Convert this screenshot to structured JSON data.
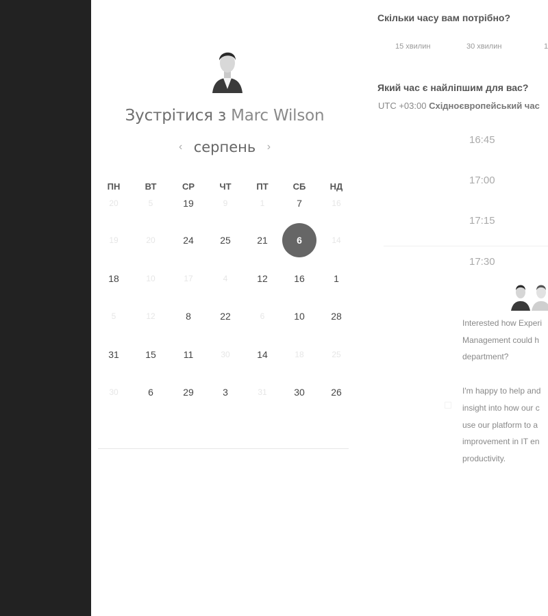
{
  "host": {
    "title_prefix": "Зустрітися з",
    "name": "Marc Wilson"
  },
  "calendar": {
    "month": "серпень",
    "prev_icon": "chevron-left-icon",
    "next_icon": "chevron-right-icon",
    "weekdays": [
      "ПН",
      "ВТ",
      "СР",
      "ЧТ",
      "ПТ",
      "СБ",
      "НД"
    ],
    "weeks": [
      [
        {
          "d": "20",
          "on": false
        },
        {
          "d": "5",
          "on": false
        },
        {
          "d": "19",
          "on": true
        },
        {
          "d": "9",
          "on": false
        },
        {
          "d": "1",
          "on": false
        },
        {
          "d": "7",
          "on": true
        },
        {
          "d": "16",
          "on": false
        }
      ],
      [
        {
          "d": "19",
          "on": false
        },
        {
          "d": "20",
          "on": false
        },
        {
          "d": "24",
          "on": true
        },
        {
          "d": "25",
          "on": true
        },
        {
          "d": "21",
          "on": true
        },
        {
          "d": "6",
          "on": true,
          "selected": true
        },
        {
          "d": "14",
          "on": false
        }
      ],
      [
        {
          "d": "18",
          "on": true
        },
        {
          "d": "10",
          "on": false
        },
        {
          "d": "17",
          "on": false
        },
        {
          "d": "4",
          "on": false
        },
        {
          "d": "12",
          "on": true
        },
        {
          "d": "16",
          "on": true
        },
        {
          "d": "1",
          "on": true
        }
      ],
      [
        {
          "d": "5",
          "on": false
        },
        {
          "d": "12",
          "on": false
        },
        {
          "d": "8",
          "on": true
        },
        {
          "d": "22",
          "on": true
        },
        {
          "d": "6",
          "on": false
        },
        {
          "d": "10",
          "on": true
        },
        {
          "d": "28",
          "on": true
        }
      ],
      [
        {
          "d": "31",
          "on": true
        },
        {
          "d": "15",
          "on": true
        },
        {
          "d": "11",
          "on": true
        },
        {
          "d": "30",
          "on": false
        },
        {
          "d": "14",
          "on": true
        },
        {
          "d": "18",
          "on": false
        },
        {
          "d": "25",
          "on": false
        }
      ],
      [
        {
          "d": "30",
          "on": false
        },
        {
          "d": "6",
          "on": true
        },
        {
          "d": "29",
          "on": true
        },
        {
          "d": "3",
          "on": true
        },
        {
          "d": "31",
          "on": false
        },
        {
          "d": "30",
          "on": true
        },
        {
          "d": "26",
          "on": true
        }
      ]
    ]
  },
  "duration": {
    "question": "Скільки часу вам потрібно?",
    "options": [
      "15 хвилин",
      "30 хвилин",
      "1"
    ]
  },
  "time": {
    "question": "Який час є найліпшим для вас?",
    "tz_offset": "UTC +03:00",
    "tz_name": "Східноєвропейський час",
    "slots": [
      "16:45",
      "17:00",
      "17:15",
      "17:30"
    ]
  },
  "promo": {
    "p1": [
      "Interested how Experi",
      "Management could h",
      "department?"
    ],
    "p2": [
      "I'm happy to help and",
      "insight into how our c",
      "use our platform to a",
      "improvement in IT en",
      "productivity."
    ]
  },
  "colors": {
    "sidebar": "#222222",
    "selected_day": "#666666"
  }
}
